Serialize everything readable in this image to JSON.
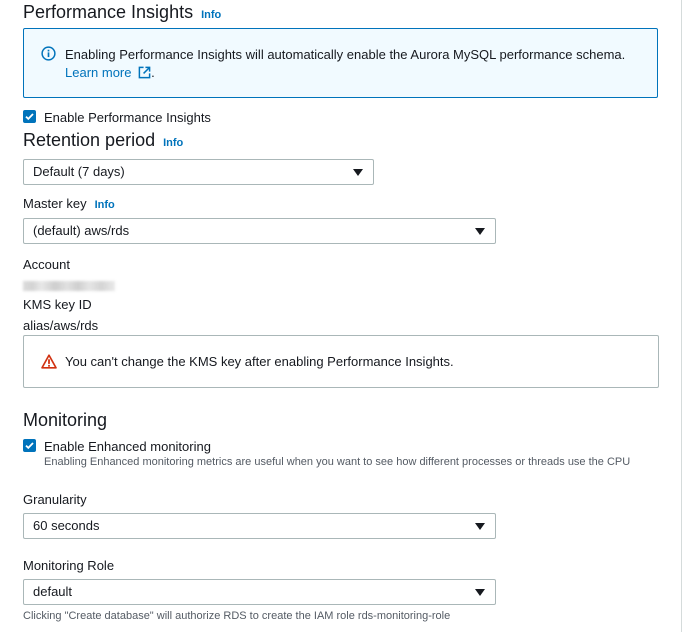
{
  "performance_insights": {
    "title": "Performance Insights",
    "info": "Info",
    "alert_text": "Enabling Performance Insights will automatically enable the Aurora MySQL performance schema.",
    "alert_link": "Learn more",
    "alert_link_suffix": ".",
    "enable_label": "Enable Performance Insights",
    "enable_checked": true
  },
  "retention": {
    "title": "Retention period",
    "info": "Info",
    "selected": "Default (7 days)"
  },
  "master_key": {
    "label": "Master key",
    "info": "Info",
    "selected": "(default) aws/rds",
    "account_label": "Account",
    "kms_label": "KMS key ID",
    "kms_value": "alias/aws/rds",
    "warning_text": "You can't change the KMS key after enabling Performance Insights."
  },
  "monitoring": {
    "title": "Monitoring",
    "enable_label": "Enable Enhanced monitoring",
    "enable_checked": true,
    "enable_desc": "Enabling Enhanced monitoring metrics are useful when you want to see how different processes or threads use the CPU",
    "granularity_label": "Granularity",
    "granularity_selected": "60 seconds",
    "role_label": "Monitoring Role",
    "role_selected": "default",
    "role_desc": "Clicking \"Create database\" will authorize RDS to create the IAM role rds-monitoring-role"
  },
  "colors": {
    "accent": "#0073bb",
    "warning": "#d13212",
    "info_bg": "#f1faff"
  }
}
